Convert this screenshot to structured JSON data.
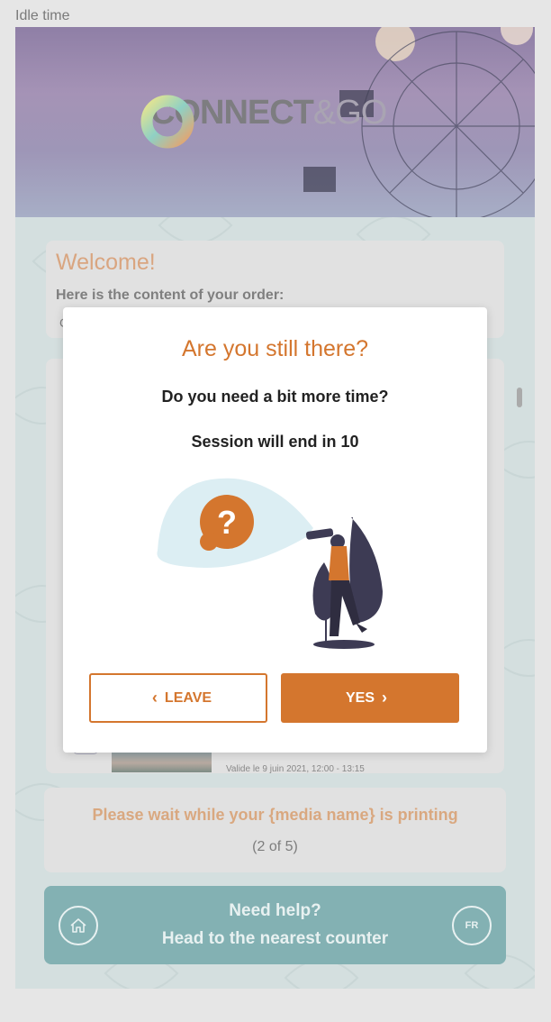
{
  "frame": {
    "label": "Idle time"
  },
  "banner": {
    "logo_text_main": "CONNECT",
    "logo_text_amp": "&",
    "logo_text_end": "GO"
  },
  "welcome": {
    "title": "Welcome!",
    "subtitle": "Here is the content of your order:",
    "cut_text": "C"
  },
  "order_item": {
    "validity": "Valide le 9 juin 2021, 12:00 - 13:15"
  },
  "printing": {
    "message": "Please wait while your {media name} is printing",
    "count": "(2 of 5)"
  },
  "help": {
    "line1": "Need help?",
    "line2": "Head to the nearest counter",
    "lang": "FR",
    "home_icon": "home-icon"
  },
  "modal": {
    "title": "Are you still there?",
    "question": "Do you need a bit more time?",
    "timer": "Session will end in 10",
    "leave_label": "LEAVE",
    "yes_label": "YES"
  },
  "colors": {
    "accent": "#d4762e",
    "help_bg": "#83b1b3",
    "screen_bg": "#d4dfdf"
  }
}
